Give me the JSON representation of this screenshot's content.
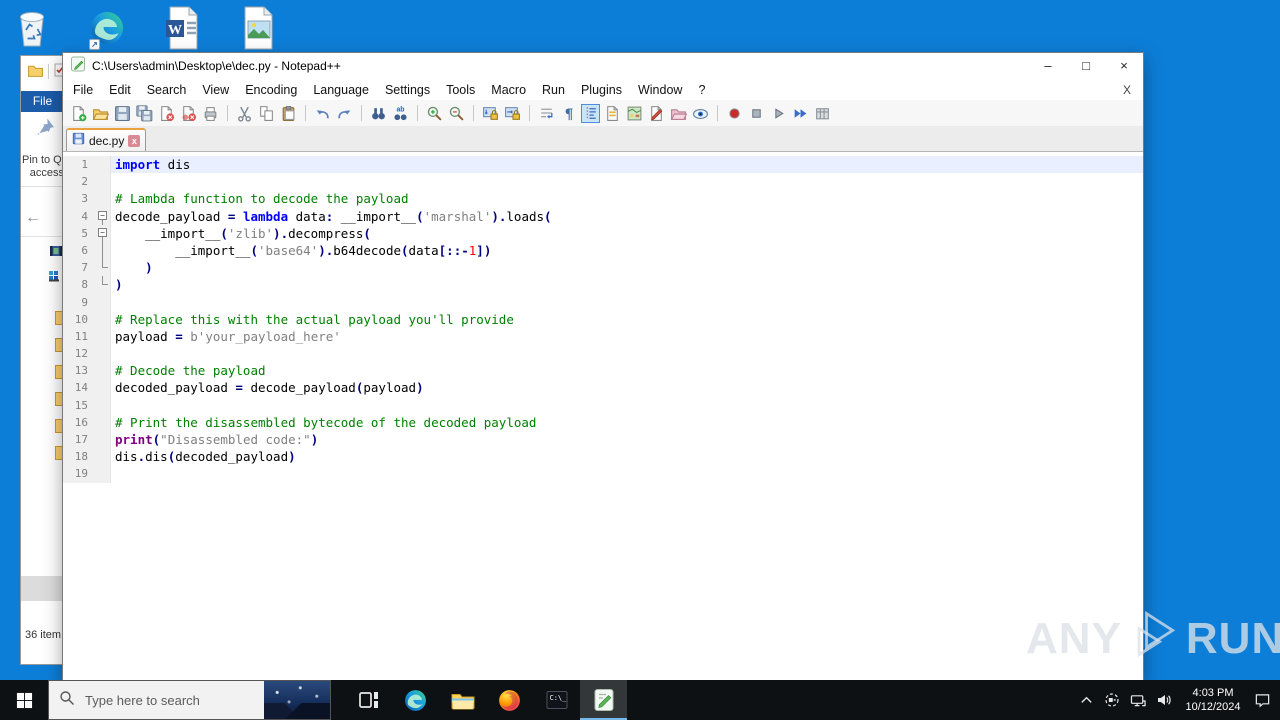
{
  "desktop": {
    "background_color": "#0d7ed8",
    "icons": [
      "recycle-bin",
      "edge-shortcut",
      "word-document",
      "image-file"
    ]
  },
  "explorer": {
    "file_tab_label": "File",
    "pin_label_line1": "Pin to Qu",
    "pin_label_line2": "access",
    "back_arrow": "←",
    "status_text": "36 item"
  },
  "notepad": {
    "window_title": "C:\\Users\\admin\\Desktop\\e\\dec.py - Notepad++",
    "menus": [
      "File",
      "Edit",
      "Search",
      "View",
      "Encoding",
      "Language",
      "Settings",
      "Tools",
      "Macro",
      "Run",
      "Plugins",
      "Window",
      "?"
    ],
    "menu_close_label": "X",
    "window_controls": {
      "minimize": "–",
      "maximize": "□",
      "close": "×"
    },
    "toolbar": [
      "new-file",
      "open-folder",
      "save",
      "save-all",
      "close-doc",
      "close-all-docs",
      "print",
      "|",
      "cut",
      "copy",
      "paste",
      "|",
      "undo",
      "redo",
      "|",
      "find",
      "replace",
      "|",
      "zoom-in",
      "zoom-out",
      "|",
      "sync-scroll-v",
      "sync-scroll-h",
      "|",
      "word-wrap",
      "show-all-chars",
      "indent-guide",
      "function-list",
      "document-map",
      "document-list",
      "folder-as-workspace",
      "document-monitor",
      "|",
      "macro-record",
      "macro-stop",
      "macro-play",
      "macro-run-multiple",
      "macro-save"
    ],
    "toolbar_active": "indent-guide",
    "tab_label": "dec.py",
    "tab_close_label": "x"
  },
  "editor": {
    "current_line": 1,
    "lines": [
      {
        "num": 1,
        "fold": "",
        "segs": [
          [
            "k",
            "import"
          ],
          [
            "p",
            " dis"
          ]
        ]
      },
      {
        "num": 2,
        "fold": "",
        "segs": []
      },
      {
        "num": 3,
        "fold": "",
        "segs": [
          [
            "c",
            "# Lambda function to decode the payload"
          ]
        ]
      },
      {
        "num": 4,
        "fold": "box",
        "segs": [
          [
            "p",
            "decode_payload "
          ],
          [
            "op",
            "="
          ],
          [
            "p",
            " "
          ],
          [
            "k",
            "lambda"
          ],
          [
            "p",
            " data"
          ],
          [
            "op",
            ":"
          ],
          [
            "p",
            " __import__"
          ],
          [
            "op",
            "("
          ],
          [
            "s",
            "'marshal'"
          ],
          [
            "op",
            ")."
          ],
          [
            "p",
            "loads"
          ],
          [
            "op",
            "("
          ]
        ]
      },
      {
        "num": 5,
        "fold": "box",
        "segs": [
          [
            "p",
            "    __import__"
          ],
          [
            "op",
            "("
          ],
          [
            "s",
            "'zlib'"
          ],
          [
            "op",
            ")."
          ],
          [
            "p",
            "decompress"
          ],
          [
            "op",
            "("
          ]
        ]
      },
      {
        "num": 6,
        "fold": "vline",
        "segs": [
          [
            "p",
            "        __import__"
          ],
          [
            "op",
            "("
          ],
          [
            "s",
            "'base64'"
          ],
          [
            "op",
            ")."
          ],
          [
            "p",
            "b64decode"
          ],
          [
            "op",
            "("
          ],
          [
            "p",
            "data"
          ],
          [
            "op",
            "[::-"
          ],
          [
            "n",
            "1"
          ],
          [
            "op",
            "])"
          ]
        ]
      },
      {
        "num": 7,
        "fold": "end",
        "segs": [
          [
            "p",
            "    "
          ],
          [
            "op",
            ")"
          ]
        ]
      },
      {
        "num": 8,
        "fold": "end",
        "segs": [
          [
            "op",
            ")"
          ]
        ]
      },
      {
        "num": 9,
        "fold": "",
        "segs": []
      },
      {
        "num": 10,
        "fold": "",
        "segs": [
          [
            "c",
            "# Replace this with the actual payload you'll provide"
          ]
        ]
      },
      {
        "num": 11,
        "fold": "",
        "segs": [
          [
            "p",
            "payload "
          ],
          [
            "op",
            "="
          ],
          [
            "p",
            " "
          ],
          [
            "s",
            "b'your_payload_here'"
          ]
        ]
      },
      {
        "num": 12,
        "fold": "",
        "segs": []
      },
      {
        "num": 13,
        "fold": "",
        "segs": [
          [
            "c",
            "# Decode the payload"
          ]
        ]
      },
      {
        "num": 14,
        "fold": "",
        "segs": [
          [
            "p",
            "decoded_payload "
          ],
          [
            "op",
            "="
          ],
          [
            "p",
            " decode_payload"
          ],
          [
            "op",
            "("
          ],
          [
            "p",
            "payload"
          ],
          [
            "op",
            ")"
          ]
        ]
      },
      {
        "num": 15,
        "fold": "",
        "segs": []
      },
      {
        "num": 16,
        "fold": "",
        "segs": [
          [
            "c",
            "# Print the disassembled bytecode of the decoded payload"
          ]
        ]
      },
      {
        "num": 17,
        "fold": "",
        "segs": [
          [
            "pr",
            "print"
          ],
          [
            "op",
            "("
          ],
          [
            "s",
            "\"Disassembled code:\""
          ],
          [
            "op",
            ")"
          ]
        ]
      },
      {
        "num": 18,
        "fold": "",
        "segs": [
          [
            "p",
            "dis"
          ],
          [
            "op",
            "."
          ],
          [
            "p",
            "dis"
          ],
          [
            "op",
            "("
          ],
          [
            "p",
            "decoded_payload"
          ],
          [
            "op",
            ")"
          ]
        ]
      },
      {
        "num": 19,
        "fold": "",
        "segs": []
      }
    ],
    "syntax_colors": {
      "keyword": "#0000ff",
      "print_keyword": "#800080",
      "operator": "#000080",
      "comment": "#008000",
      "string": "#808080",
      "number": "#ff0000",
      "plain": "#000000",
      "current_line_bg": "#e9efff"
    }
  },
  "watermark": {
    "left_text": "ANY",
    "right_text": "RUN"
  },
  "taskbar": {
    "search_placeholder": "Type here to search",
    "apps": [
      "task-view",
      "edge",
      "file-explorer",
      "firefox",
      "cmd",
      "notepad-plus-plus"
    ],
    "active_app": "notepad-plus-plus",
    "tray_icons": [
      "chevron-up",
      "meet-now",
      "network",
      "volume"
    ],
    "clock_time": "4:03 PM",
    "clock_date": "10/12/2024",
    "action_center": "action-center"
  }
}
